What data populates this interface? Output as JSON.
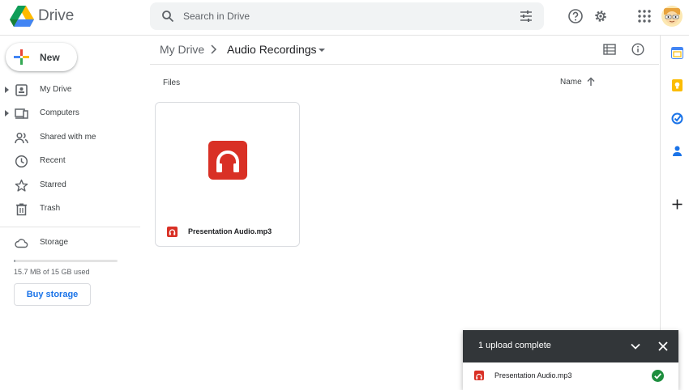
{
  "app": {
    "name": "Drive"
  },
  "search": {
    "placeholder": "Search in Drive"
  },
  "sidebar": {
    "new_label": "New",
    "items": [
      {
        "label": "My Drive",
        "icon": "my-drive-icon",
        "expandable": true
      },
      {
        "label": "Computers",
        "icon": "computers-icon",
        "expandable": true
      },
      {
        "label": "Shared with me",
        "icon": "shared-icon",
        "expandable": false
      },
      {
        "label": "Recent",
        "icon": "clock-icon",
        "expandable": false
      },
      {
        "label": "Starred",
        "icon": "star-icon",
        "expandable": false
      },
      {
        "label": "Trash",
        "icon": "trash-icon",
        "expandable": false
      }
    ],
    "storage": {
      "label": "Storage",
      "used_text": "15.7 MB of 15 GB used",
      "used_fraction": 0.001,
      "buy_label": "Buy storage"
    }
  },
  "breadcrumb": {
    "parent": "My Drive",
    "current": "Audio Recordings"
  },
  "main": {
    "section_label": "Files",
    "sort_label": "Name",
    "sort_direction": "ascending",
    "files": [
      {
        "name": "Presentation Audio.mp3",
        "type": "audio",
        "icon": "headphones-icon"
      }
    ]
  },
  "upload_panel": {
    "title": "1 upload complete",
    "items": [
      {
        "name": "Presentation Audio.mp3",
        "status": "complete"
      }
    ]
  },
  "colors": {
    "audio_red": "#d93025",
    "accent_blue": "#1a73e8",
    "success_green": "#1e8e3e",
    "toast_dark": "#323639"
  }
}
